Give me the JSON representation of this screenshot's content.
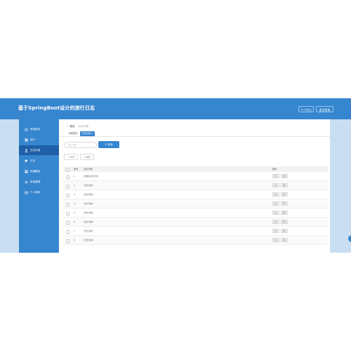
{
  "app": {
    "title": "基于SpringBoot设计的旅行日志"
  },
  "header": {
    "profile_label": "个人中心",
    "logout_label": "退出登录"
  },
  "sidebar": {
    "items": [
      {
        "label": "系统首页",
        "icon": "home-icon",
        "active": false,
        "has_arrow": false
      },
      {
        "label": "用户",
        "icon": "grid-icon",
        "active": false,
        "has_arrow": false
      },
      {
        "label": "日志分类",
        "icon": "user-icon",
        "active": true,
        "has_arrow": false
      },
      {
        "label": "日志",
        "icon": "flag-icon",
        "active": false,
        "has_arrow": false
      },
      {
        "label": "轮播图设",
        "icon": "grid-icon",
        "active": false,
        "has_arrow": false
      },
      {
        "label": "系统管理",
        "icon": "gear-icon",
        "active": false,
        "has_arrow": true
      },
      {
        "label": "个人资料",
        "icon": "id-card-icon",
        "active": false,
        "has_arrow": true
      }
    ]
  },
  "breadcrumb": {
    "home": "首页",
    "current": "日志分类"
  },
  "tabs": [
    {
      "label": "系统首页",
      "active": false
    },
    {
      "label": "日志分类 ×",
      "active": true
    }
  ],
  "search": {
    "placeholder": "日志分类"
  },
  "query_button": "查询",
  "actions": {
    "add": "+ 新增",
    "delete": "删除"
  },
  "table": {
    "headers": [
      "序号",
      "日志分类",
      "操作"
    ],
    "row_buttons": [
      "修改",
      "删除"
    ],
    "rows": [
      {
        "idx": "1",
        "name": "去哪玩好玩日志"
      },
      {
        "idx": "2",
        "name": "日志分类2"
      },
      {
        "idx": "3",
        "name": "日志分类3"
      },
      {
        "idx": "4",
        "name": "日志分类4"
      },
      {
        "idx": "5",
        "name": "日志分类5"
      },
      {
        "idx": "6",
        "name": "日志分类6"
      },
      {
        "idx": "7",
        "name": "日志分类7"
      },
      {
        "idx": "8",
        "name": "日志分类8"
      }
    ]
  },
  "colors": {
    "primary": "#3685cf",
    "sidebar_active": "#1f5fa7",
    "page_bg": "#c9def2"
  }
}
